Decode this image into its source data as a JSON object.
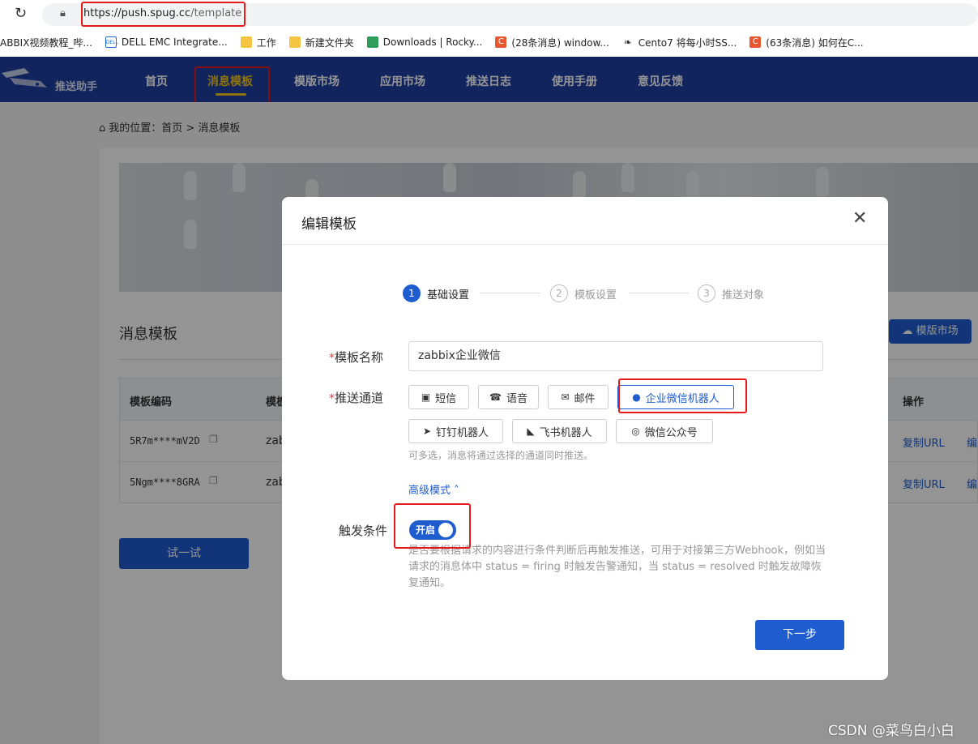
{
  "browser": {
    "url_host": "https://push.spug.cc",
    "url_path": "/template",
    "bookmarks": [
      {
        "label": "ABBIX视频教程_哔...",
        "icon": "none"
      },
      {
        "label": "DELL EMC Integrate...",
        "icon": "dell-icon"
      },
      {
        "label": "工作",
        "icon": "folder-icon"
      },
      {
        "label": "新建文件夹",
        "icon": "folder-icon"
      },
      {
        "label": "Downloads | Rocky...",
        "icon": "rocky-icon"
      },
      {
        "label": "(28条消息) window...",
        "icon": "csdn-icon"
      },
      {
        "label": "Cento7 将每小时SS...",
        "icon": "fox-icon"
      },
      {
        "label": "(63条消息) 如何在C...",
        "icon": "csdn-icon"
      }
    ]
  },
  "nav": {
    "logo": "推送助手",
    "items": [
      "首页",
      "消息模板",
      "模版市场",
      "应用市场",
      "推送日志",
      "使用手册",
      "意见反馈"
    ],
    "active": "消息模板"
  },
  "page": {
    "breadcrumb": "我的位置：首页 > 消息模板",
    "section_title": "消息模板",
    "market_button": "模版市场",
    "table": {
      "headers": [
        "模板编码",
        "模板",
        "操作"
      ],
      "rows": [
        {
          "code": "5R7m****mV2D",
          "name": "zab",
          "copy": "复制URL",
          "edit": "编"
        },
        {
          "code": "5Ngm****8GRA",
          "name": "zab",
          "copy": "复制URL",
          "edit": "编"
        }
      ]
    },
    "try_button": "试一试"
  },
  "modal": {
    "title": "编辑模板",
    "steps": [
      {
        "num": "1",
        "label": "基础设置",
        "active": true
      },
      {
        "num": "2",
        "label": "模板设置",
        "active": false
      },
      {
        "num": "3",
        "label": "推送对象",
        "active": false
      }
    ],
    "name_label": "模板名称",
    "name_value": "zabbix企业微信",
    "channel_label": "推送通道",
    "channels": [
      {
        "label": "短信",
        "icon": "message-icon",
        "selected": false
      },
      {
        "label": "语音",
        "icon": "phone-icon",
        "selected": false
      },
      {
        "label": "邮件",
        "icon": "mail-icon",
        "selected": false
      },
      {
        "label": "企业微信机器人",
        "icon": "wecom-icon",
        "selected": true
      },
      {
        "label": "钉钉机器人",
        "icon": "dingtalk-icon",
        "selected": false
      },
      {
        "label": "飞书机器人",
        "icon": "feishu-icon",
        "selected": false
      },
      {
        "label": "微信公众号",
        "icon": "wechat-icon",
        "selected": false
      }
    ],
    "channel_hint": "可多选，消息将通过选择的通道同时推送。",
    "advanced_link": "高级模式",
    "trigger_label": "触发条件",
    "trigger_toggle": "开启",
    "trigger_on": true,
    "trigger_desc": "是否要根据请求的内容进行条件判断后再触发推送，可用于对接第三方Webhook，例如当请求的消息体中 status = firing 时触发告警通知，当 status = resolved 时触发故障恢复通知。",
    "next_button": "下一步"
  },
  "watermark": "CSDN @菜鸟白小白",
  "colors": {
    "primary": "#1e5ccf",
    "nav_bg": "#1e3fa3",
    "highlight_box": "#e51b1b"
  }
}
